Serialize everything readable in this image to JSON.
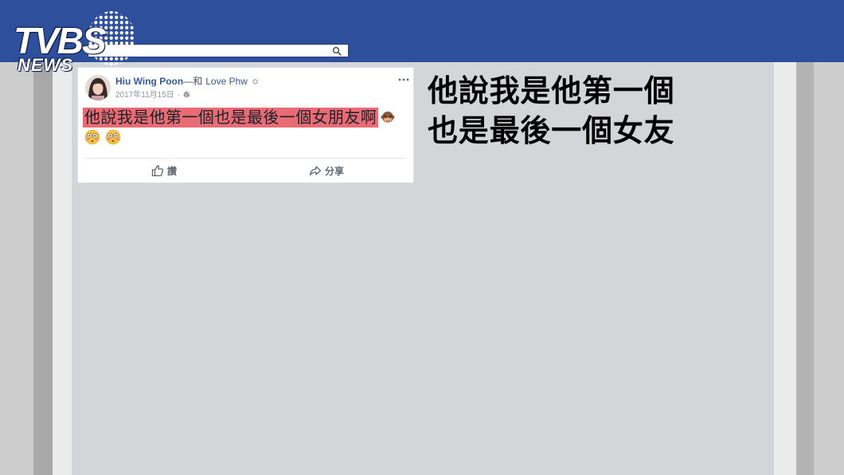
{
  "logo": {
    "brand": "TVBS",
    "sub": "NEWS"
  },
  "header": {
    "search_value": "",
    "search_icon": "search-icon"
  },
  "post": {
    "author": "Hiu Wing Poon",
    "with_label": "—和",
    "tagged": "Love Phw",
    "date": "2017年11月15日",
    "date_separator": "·",
    "visibility_icon": "globe-icon",
    "more_icon": "more-options-icon",
    "text": "他說我是他第一個也是最後一個女朋友啊",
    "inline_emoji_icon": "see-no-evil-monkey-icon",
    "second_line_emoji_icons": [
      "flushed-face-icon",
      "flushed-face-icon"
    ],
    "actions": {
      "like_label": "讚",
      "like_icon": "thumbs-up-icon",
      "share_label": "分享",
      "share_icon": "share-arrow-icon"
    }
  },
  "caption": {
    "line1": "他說我是他第一個",
    "line2": "也是最後一個女友"
  },
  "colors": {
    "header_blue": "#2d4f9c",
    "link_blue": "#365899",
    "highlight": "#e96c75",
    "caption": "#000000"
  }
}
